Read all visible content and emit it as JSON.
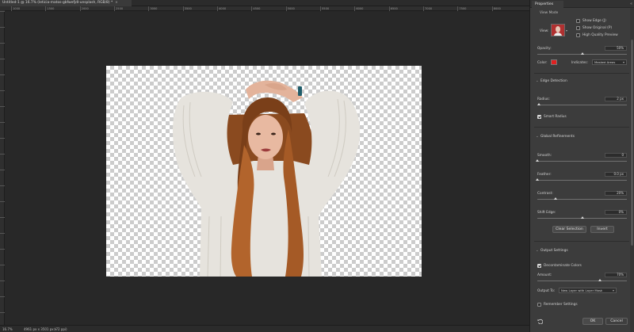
{
  "document": {
    "tab_title": "Untitled-1 @ 16.7% (leticia-matos-gbfwefjdl-unsplash, RGB/8) *",
    "tab_close": "×"
  },
  "ruler": {
    "top_ticks": [
      "1000",
      "1500",
      "2000",
      "2500",
      "3000",
      "3500",
      "4000",
      "4500",
      "5000",
      "5500",
      "6000",
      "6500",
      "7000",
      "7500",
      "8000"
    ]
  },
  "status": {
    "zoom": "16.7%",
    "doc_size": "4961 px x 3501 px (72 ppi)",
    "arrow": ">"
  },
  "properties": {
    "tab_label": "Properties",
    "collapse_glyph": "«",
    "view_mode_header": "View Mode",
    "view_label": "View:",
    "show_edge": "Show Edge (J)",
    "show_original": "Show Original (P)",
    "high_quality_preview": "High Quality Preview",
    "opacity_label": "Opacity:",
    "opacity_value": "50%",
    "opacity_level": 0.5,
    "color_label": "Color:",
    "overlay_color": "#e02020",
    "indicates_label": "Indicates:",
    "indicates_value": "Masked Areas",
    "edge_detection": {
      "title": "Edge Detection",
      "radius_label": "Radius:",
      "radius_value": "2 px",
      "radius_level": 0.02,
      "smart_radius": "Smart Radius",
      "smart_radius_checked": true
    },
    "global_refinements": {
      "title": "Global Refinements",
      "smooth_label": "Smooth:",
      "smooth_value": "0",
      "smooth_level": 0,
      "feather_label": "Feather:",
      "feather_value": "0.0 px",
      "feather_level": 0,
      "contrast_label": "Contrast:",
      "contrast_value": "20%",
      "contrast_level": 0.2,
      "shift_edge_label": "Shift Edge:",
      "shift_edge_value": "0%",
      "shift_edge_level": 0.5
    },
    "clear_selection": "Clear Selection",
    "invert": "Invert",
    "output_settings": {
      "title": "Output Settings",
      "decontaminate": "Decontaminate Colors",
      "decontaminate_checked": true,
      "amount_label": "Amount:",
      "amount_value": "70%",
      "amount_level": 0.7,
      "output_to_label": "Output To:",
      "output_to_value": "New Layer with Layer Mask"
    },
    "remember_settings": "Remember Settings",
    "ok": "OK",
    "cancel": "Cancel"
  }
}
